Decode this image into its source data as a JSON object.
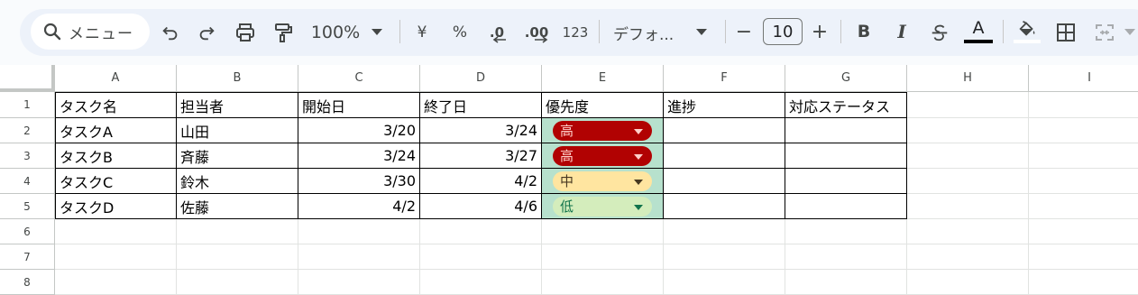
{
  "toolbar": {
    "search_placeholder": "メニュー",
    "zoom": "100%",
    "currency_symbol": "¥",
    "percent_symbol": "%",
    "decimal_decrease": ".0",
    "decimal_increase": ".00",
    "number_format": "123",
    "font_name": "デフォ...",
    "font_size": "10",
    "minus": "−",
    "plus": "+",
    "bold": "B",
    "italic": "I",
    "text_color_letter": "A",
    "colors": {
      "pill_bg": "#edf2fa",
      "text_color_bar": "#000000"
    }
  },
  "columns": [
    "A",
    "B",
    "C",
    "D",
    "E",
    "F",
    "G",
    "H",
    "I"
  ],
  "rows": [
    "1",
    "2",
    "3",
    "4",
    "5",
    "6",
    "7",
    "8"
  ],
  "table": {
    "headers": [
      "タスク名",
      "担当者",
      "開始日",
      "終了日",
      "優先度",
      "進捗",
      "対応ステータス"
    ],
    "data": [
      {
        "task": "タスクA",
        "owner": "山田",
        "start": "3/20",
        "end": "3/24",
        "priority": "高",
        "priority_level": "high"
      },
      {
        "task": "タスクB",
        "owner": "斉藤",
        "start": "3/24",
        "end": "3/27",
        "priority": "高",
        "priority_level": "high"
      },
      {
        "task": "タスクC",
        "owner": "鈴木",
        "start": "3/30",
        "end": "4/2",
        "priority": "中",
        "priority_level": "medium"
      },
      {
        "task": "タスクD",
        "owner": "佐藤",
        "start": "4/2",
        "end": "4/6",
        "priority": "低",
        "priority_level": "low"
      }
    ]
  },
  "chip_colors": {
    "high": {
      "bg": "#b10202",
      "fg": "#ffcfc9"
    },
    "medium": {
      "bg": "#ffe5a0",
      "fg": "#473821"
    },
    "low": {
      "bg": "#d4edbc",
      "fg": "#11734b"
    }
  },
  "priority_column_bg": "#b7e1cd"
}
